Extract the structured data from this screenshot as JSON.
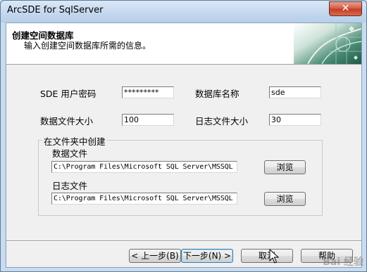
{
  "window": {
    "title": "ArcSDE for SqlServer",
    "close_label": "✕"
  },
  "header": {
    "title": "创建空间数据库",
    "subtitle": "输入创建空间数据库所需的信息。"
  },
  "form": {
    "sde_password_label": "SDE 用户密码",
    "sde_password_value": "*********",
    "db_name_label": "数据库名称",
    "db_name_value": "sde",
    "data_size_label": "数据文件大小",
    "data_size_value": "100",
    "log_size_label": "日志文件大小",
    "log_size_value": "30"
  },
  "folder_group": {
    "title": "在文件夹中创建",
    "data_file_label": "数据文件",
    "data_file_path": "C:\\Program Files\\Microsoft SQL Server\\MSSQL",
    "data_browse_label": "浏览",
    "log_file_label": "日志文件",
    "log_file_path": "C:\\Program Files\\Microsoft SQL Server\\MSSQL",
    "log_browse_label": "浏览"
  },
  "buttons": {
    "back_label": "< 上一步(B)",
    "next_label": "下一步(N) >",
    "cancel_label": "取消",
    "help_label": "帮助"
  },
  "watermark": "Bai 经验"
}
